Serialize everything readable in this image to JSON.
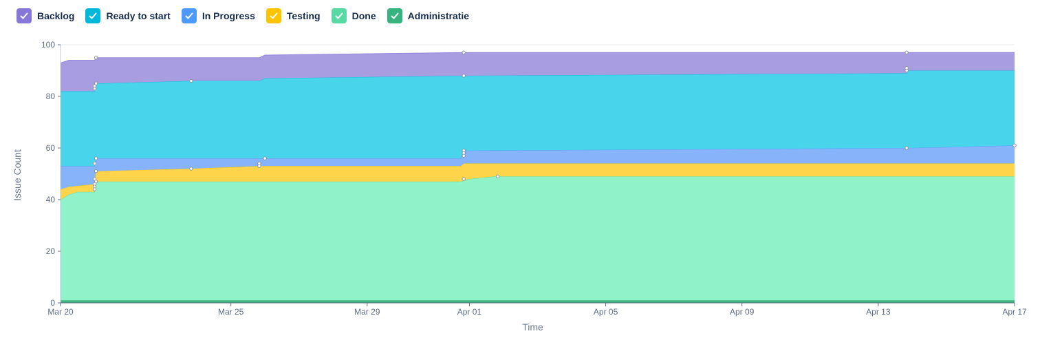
{
  "chart_data": {
    "type": "area",
    "stacked": true,
    "xlabel": "Time",
    "ylabel": "Issue Count",
    "ylim": [
      0,
      100
    ],
    "yticks": [
      0,
      20,
      40,
      60,
      80,
      100
    ],
    "xlim": [
      "2021-03-20",
      "2021-04-17"
    ],
    "xtick_values": [
      "2021-03-20",
      "2021-03-25",
      "2021-03-29",
      "2021-04-01",
      "2021-04-05",
      "2021-04-09",
      "2021-04-13",
      "2021-04-17"
    ],
    "xtick_labels": [
      "Mar 20",
      "Mar 25",
      "Mar 29",
      "Apr 01",
      "Apr 05",
      "Apr 09",
      "Apr 13",
      "Apr 17"
    ],
    "grid": "horizontal",
    "legend_position": "top-left",
    "series": [
      {
        "name": "Administratie",
        "color": "#3fb57f",
        "check_color": "#36b37e",
        "points": [
          [
            "2021-03-20",
            1
          ],
          [
            "2021-04-17",
            1
          ]
        ]
      },
      {
        "name": "Done",
        "color": "#8ff2c8",
        "check_color": "#57d9a3",
        "points": [
          [
            "2021-03-20",
            40
          ],
          [
            "2021-03-20 06:00",
            42
          ],
          [
            "2021-03-20 12:00",
            43
          ],
          [
            "2021-03-21 00:00",
            43
          ],
          [
            "2021-03-21 01:00",
            47
          ],
          [
            "2021-03-31 18:00",
            47
          ],
          [
            "2021-04-01 00:00",
            48
          ],
          [
            "2021-04-01 18:00",
            49
          ],
          [
            "2021-04-17",
            49
          ]
        ]
      },
      {
        "name": "Testing",
        "color": "#fed44a",
        "check_color": "#ffc400",
        "points": [
          [
            "2021-03-20",
            44
          ],
          [
            "2021-03-20 06:00",
            45
          ],
          [
            "2021-03-21 00:00",
            46
          ],
          [
            "2021-03-21 01:00",
            51
          ],
          [
            "2021-03-23 20:00",
            52
          ],
          [
            "2021-03-25 20:00",
            53
          ],
          [
            "2021-03-31 18:00",
            53
          ],
          [
            "2021-03-31 20:00",
            54
          ],
          [
            "2021-04-17",
            54
          ]
        ]
      },
      {
        "name": "In Progress",
        "color": "#86b3fa",
        "check_color": "#4c9aff",
        "points": [
          [
            "2021-03-20",
            53
          ],
          [
            "2021-03-21 00:00",
            53
          ],
          [
            "2021-03-21 01:00",
            56
          ],
          [
            "2021-03-31 18:00",
            56
          ],
          [
            "2021-03-31 20:00",
            59
          ],
          [
            "2021-04-13 20:00",
            60
          ],
          [
            "2021-04-17",
            61
          ]
        ]
      },
      {
        "name": "Ready to start",
        "color": "#48d4ea",
        "check_color": "#00b8d9",
        "points": [
          [
            "2021-03-20",
            82
          ],
          [
            "2021-03-21 00:00",
            82
          ],
          [
            "2021-03-21 01:00",
            85
          ],
          [
            "2021-03-23 20:00",
            86
          ],
          [
            "2021-03-25 20:00",
            86
          ],
          [
            "2021-03-26 00:00",
            87
          ],
          [
            "2021-03-31 20:00",
            88
          ],
          [
            "2021-04-13 20:00",
            89
          ],
          [
            "2021-04-13 21:00",
            90
          ],
          [
            "2021-04-17",
            90
          ]
        ]
      },
      {
        "name": "Backlog",
        "color": "#a99de2",
        "check_color": "#8777d9",
        "points": [
          [
            "2021-03-20",
            93
          ],
          [
            "2021-03-20 06:00",
            94
          ],
          [
            "2021-03-21 00:00",
            94
          ],
          [
            "2021-03-21 01:00",
            95
          ],
          [
            "2021-03-25 20:00",
            95
          ],
          [
            "2021-03-26 00:00",
            96
          ],
          [
            "2021-03-31 20:00",
            97
          ],
          [
            "2021-04-17",
            97
          ]
        ]
      }
    ],
    "markers": [
      [
        "2021-03-21 01:00",
        95
      ],
      [
        "2021-03-21 01:00",
        85
      ],
      [
        "2021-03-21 00:00",
        84
      ],
      [
        "2021-03-21 00:00",
        83
      ],
      [
        "2021-03-21 01:00",
        56
      ],
      [
        "2021-03-21 00:00",
        54
      ],
      [
        "2021-03-21 01:00",
        51
      ],
      [
        "2021-03-21 00:00",
        48
      ],
      [
        "2021-03-21 01:00",
        47
      ],
      [
        "2021-03-21 00:00",
        46
      ],
      [
        "2021-03-21 00:00",
        45
      ],
      [
        "2021-03-21 00:00",
        44
      ],
      [
        "2021-03-23 20:00",
        86
      ],
      [
        "2021-03-23 20:00",
        52
      ],
      [
        "2021-03-26 00:00",
        56
      ],
      [
        "2021-03-25 20:00",
        54
      ],
      [
        "2021-03-25 20:00",
        53
      ],
      [
        "2021-03-31 20:00",
        97
      ],
      [
        "2021-03-31 20:00",
        88
      ],
      [
        "2021-03-31 20:00",
        59
      ],
      [
        "2021-03-31 20:00",
        58
      ],
      [
        "2021-03-31 20:00",
        57
      ],
      [
        "2021-03-31 20:00",
        48
      ],
      [
        "2021-04-01 20:00",
        49
      ],
      [
        "2021-04-13 20:00",
        97
      ],
      [
        "2021-04-13 20:00",
        91
      ],
      [
        "2021-04-13 20:00",
        90
      ],
      [
        "2021-04-13 20:00",
        60
      ],
      [
        "2021-04-17",
        61
      ]
    ]
  },
  "legend": [
    {
      "label": "Backlog",
      "color": "#8777d9"
    },
    {
      "label": "Ready to start",
      "color": "#00b8d9"
    },
    {
      "label": "In Progress",
      "color": "#4c9aff"
    },
    {
      "label": "Testing",
      "color": "#ffc400"
    },
    {
      "label": "Done",
      "color": "#57d9a3"
    },
    {
      "label": "Administratie",
      "color": "#36b37e"
    }
  ]
}
